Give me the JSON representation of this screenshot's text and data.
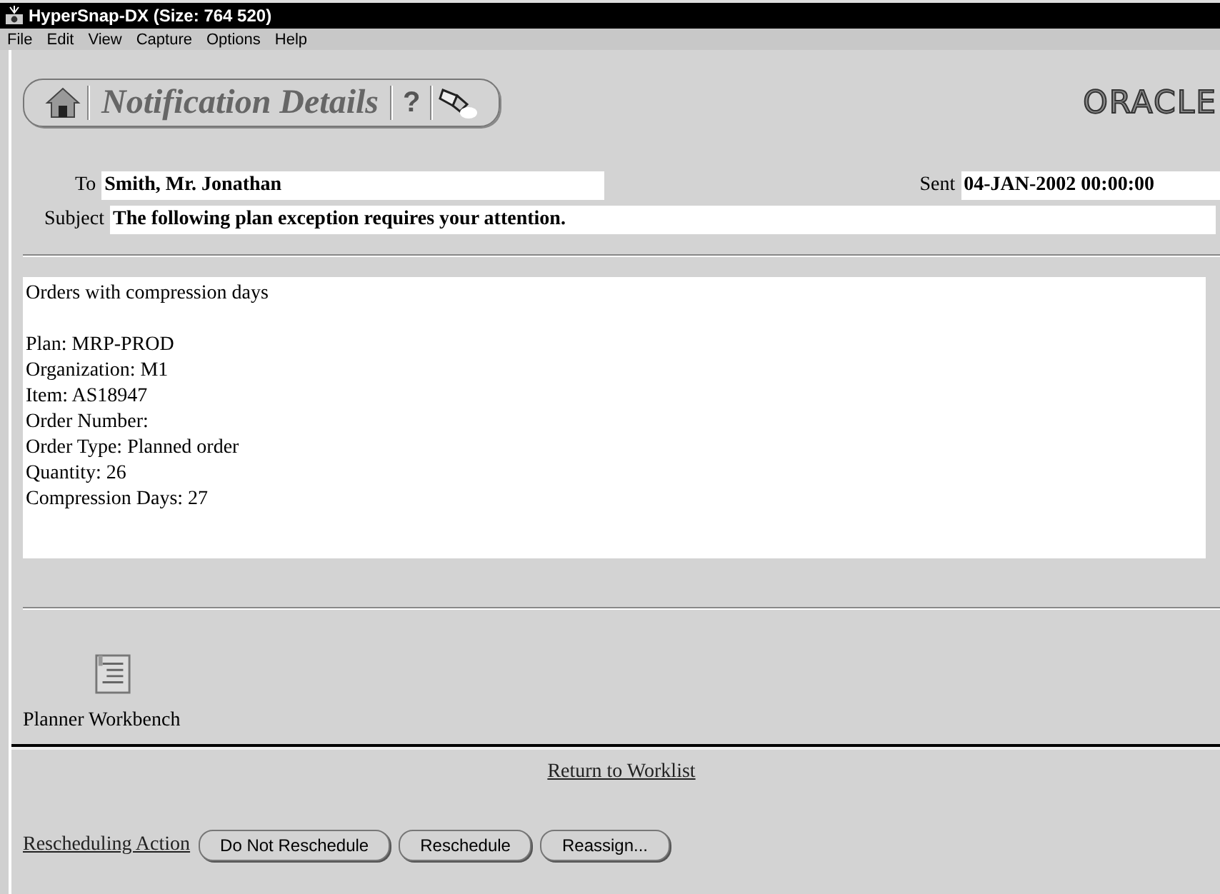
{
  "window": {
    "title": "HyperSnap-DX (Size: 764 520)"
  },
  "menu": [
    "File",
    "Edit",
    "View",
    "Capture",
    "Options",
    "Help"
  ],
  "header": {
    "title": "Notification Details",
    "help": "?",
    "logo": "ORACLE"
  },
  "fields": [
    {
      "label": "To",
      "value": "Smith, Mr. Jonathan"
    },
    {
      "label": "Sent",
      "value": "04-JAN-2002 00:00:00"
    },
    {
      "label": "Subject",
      "value": "The following plan exception requires your attention."
    }
  ],
  "message": {
    "heading": "Orders with compression days",
    "lines": [
      "Plan: MRP-PROD",
      "Organization: M1",
      "Item: AS18947",
      "Order Number:",
      "Order Type: Planned order",
      "Quantity: 26",
      "Compression Days: 27"
    ]
  },
  "attachment": {
    "label": "Planner Workbench"
  },
  "return_link": "Return to Worklist",
  "action_label": "Rescheduling Action",
  "buttons": [
    "Do Not Reschedule",
    "Reschedule",
    "Reassign..."
  ]
}
